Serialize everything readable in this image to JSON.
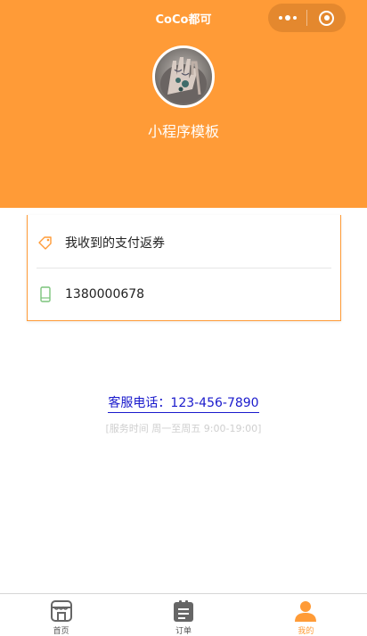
{
  "nav": {
    "title": "CoCo都可"
  },
  "profile": {
    "name": "小程序模板"
  },
  "card": {
    "rows": [
      {
        "label": "我收到的支付返券",
        "icon": "coupon-tag-icon",
        "icon_color": "#ff9b37"
      },
      {
        "label": "1380000678",
        "icon": "phone-icon",
        "icon_color": "#7cc47c"
      }
    ]
  },
  "service": {
    "phone_text": "客服电话：123-456-7890",
    "hours_text": "[服务时间 周一至周五 9:00-19:00]"
  },
  "tabbar": {
    "items": [
      {
        "label": "首页",
        "icon": "store-icon",
        "active": false
      },
      {
        "label": "订单",
        "icon": "order-list-icon",
        "active": false
      },
      {
        "label": "我的",
        "icon": "user-icon",
        "active": true
      }
    ]
  },
  "colors": {
    "primary": "#ff9b37",
    "link": "#1a1acc",
    "muted": "#cfcfcf"
  }
}
